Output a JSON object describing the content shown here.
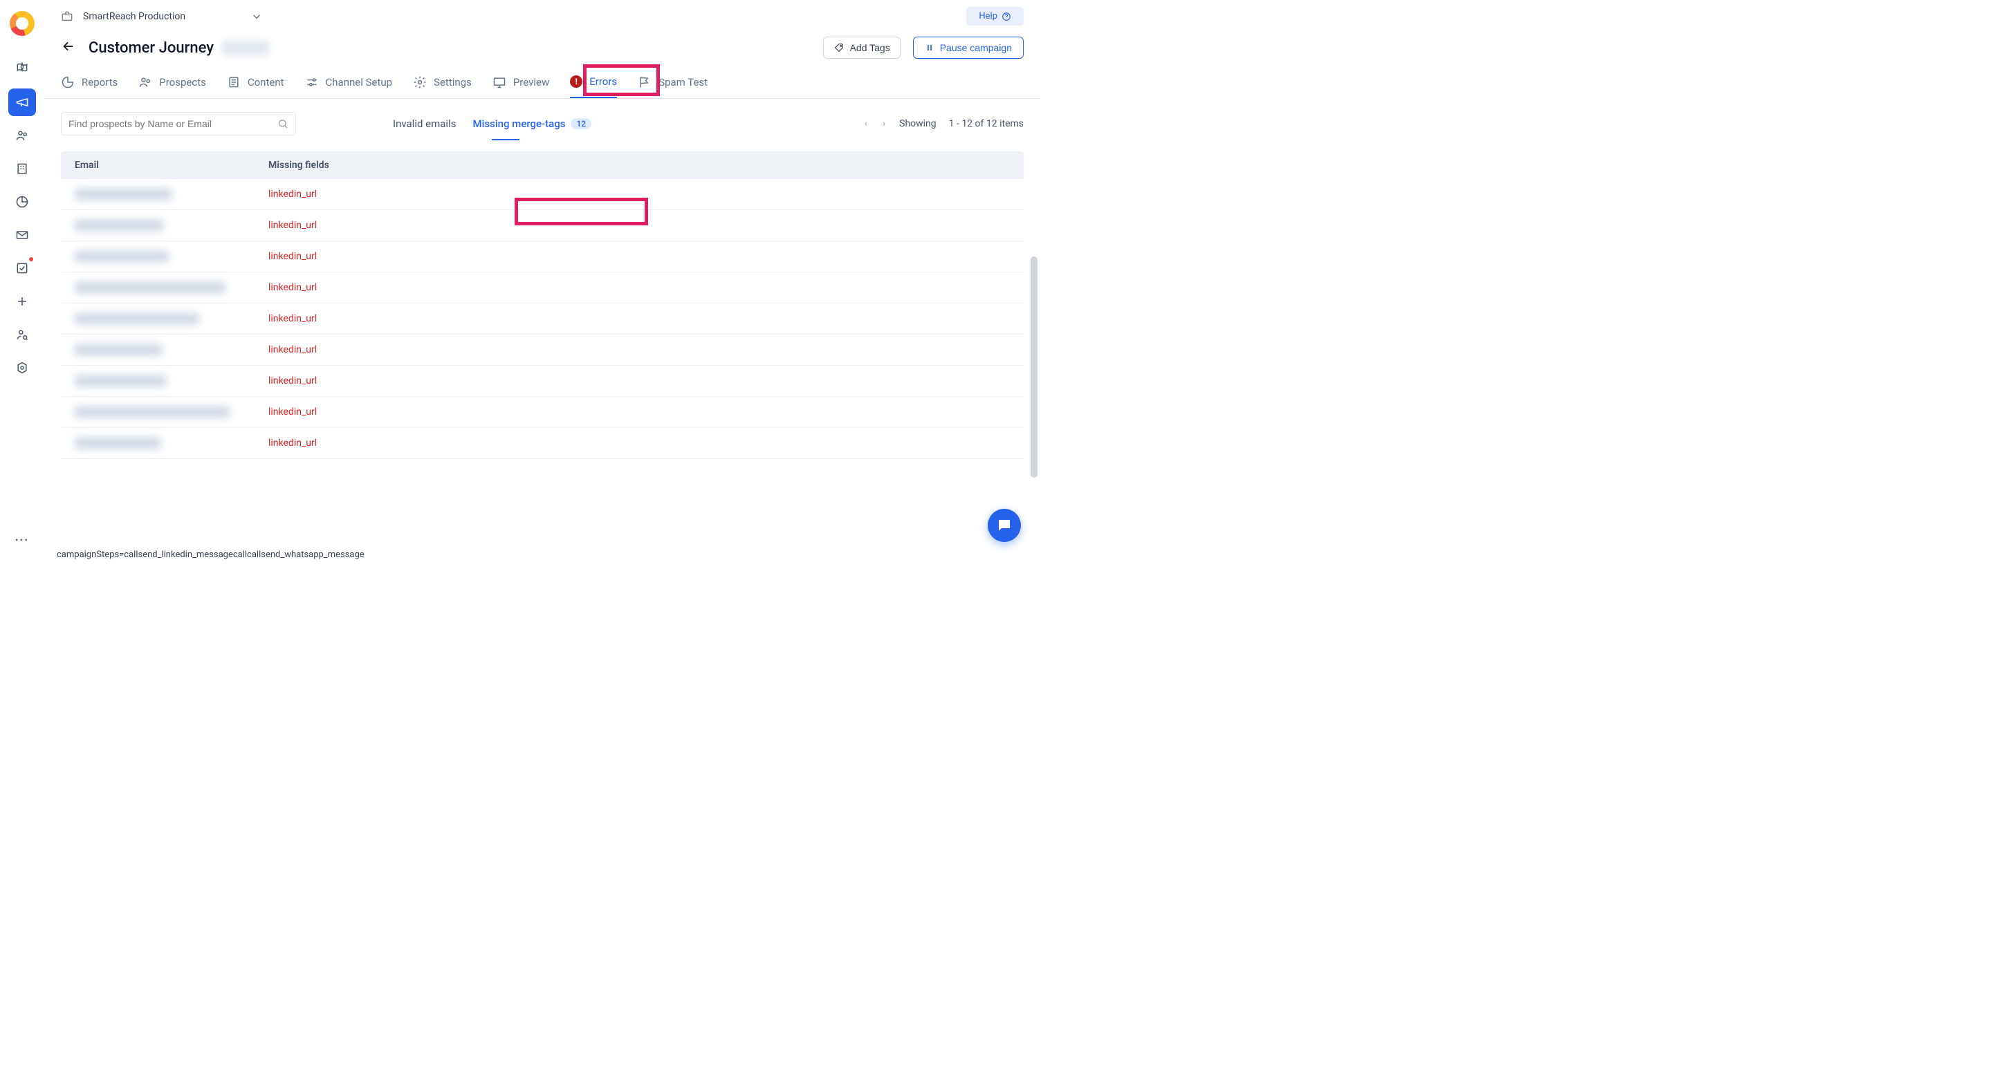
{
  "workspace": {
    "name": "SmartReach Production"
  },
  "help": {
    "label": "Help"
  },
  "page": {
    "title": "Customer Journey"
  },
  "actions": {
    "add_tags": "Add Tags",
    "pause": "Pause campaign"
  },
  "tabs": {
    "reports": "Reports",
    "prospects": "Prospects",
    "content": "Content",
    "channel": "Channel Setup",
    "settings": "Settings",
    "preview": "Preview",
    "errors": "Errors",
    "spam": "Spam Test"
  },
  "search": {
    "placeholder": "Find prospects by Name or Email"
  },
  "sub_tabs": {
    "invalid": "Invalid emails",
    "merge": "Missing merge-tags",
    "merge_count": "12"
  },
  "pager": {
    "showing": "Showing",
    "range": "1 - 12 of 12 items"
  },
  "columns": {
    "email": "Email",
    "missing": "Missing fields"
  },
  "rows": [
    {
      "email_width": 140,
      "missing": "linkedin_url"
    },
    {
      "email_width": 128,
      "missing": "linkedin_url"
    },
    {
      "email_width": 136,
      "missing": "linkedin_url"
    },
    {
      "email_width": 218,
      "missing": "linkedin_url"
    },
    {
      "email_width": 180,
      "missing": "linkedin_url"
    },
    {
      "email_width": 126,
      "missing": "linkedin_url"
    },
    {
      "email_width": 132,
      "missing": "linkedin_url"
    },
    {
      "email_width": 224,
      "missing": "linkedin_url"
    },
    {
      "email_width": 124,
      "missing": "linkedin_url"
    }
  ],
  "footer": {
    "text": "campaignSteps=callsend_linkedin_messagecallcallsend_whatsapp_message"
  }
}
